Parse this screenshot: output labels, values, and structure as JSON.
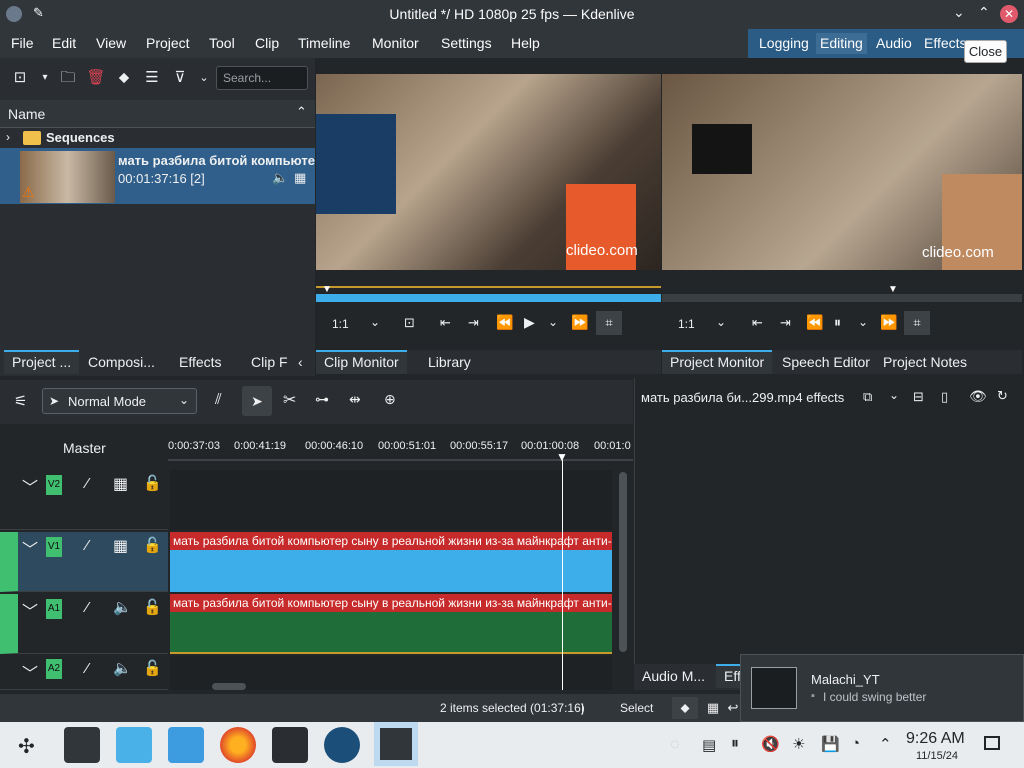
{
  "window": {
    "title": "Untitled */ HD 1080p 25 fps — Kdenlive",
    "tooltip": "Close"
  },
  "menu": [
    "File",
    "Edit",
    "View",
    "Project",
    "Tool",
    "Clip",
    "Timeline",
    "Monitor",
    "Settings",
    "Help"
  ],
  "layouts": [
    "Logging",
    "Editing",
    "Audio",
    "Effects"
  ],
  "bin": {
    "search_placeholder": "Search...",
    "column_name": "Name",
    "folder": "Sequences",
    "clip_name": "мать разбила битой компьютер",
    "clip_duration": "00:01:37:16 [2]",
    "tabs": [
      "Project ...",
      "Composi...",
      "Effects",
      "Clip F"
    ]
  },
  "clip_monitor": {
    "watermark": "clideo.com",
    "zoom": "1:1",
    "tabs": [
      "Clip Monitor",
      "Library"
    ]
  },
  "project_monitor": {
    "watermark": "clideo.com",
    "zoom": "1:1",
    "tabs": [
      "Project Monitor",
      "Speech Editor",
      "Project Notes"
    ]
  },
  "timeline": {
    "mode": "Normal Mode",
    "master": "Master",
    "ruler": [
      "0:00:37:03",
      "0:00:41:19",
      "00:00:46:10",
      "00:00:51:01",
      "00:00:55:17",
      "00:01:00:08",
      "00:01:0"
    ],
    "tracks": [
      "V2",
      "V1",
      "A1",
      "A2"
    ],
    "clip_text": "мать разбила битой компьютер сыну в реальной жизни из-за майнкрафт анти-гри"
  },
  "effects_panel": {
    "title": "мать разбила би...299.mp4 effects",
    "tabs": [
      "Audio M...",
      "Eff"
    ]
  },
  "status": {
    "selection": "2 items selected (01:37:16)",
    "separator": "|",
    "tool": "Select"
  },
  "notification": {
    "user": "Malachi_YT",
    "message": "I could swing better"
  },
  "clock": {
    "time": "9:26 AM",
    "date": "11/15/24"
  }
}
